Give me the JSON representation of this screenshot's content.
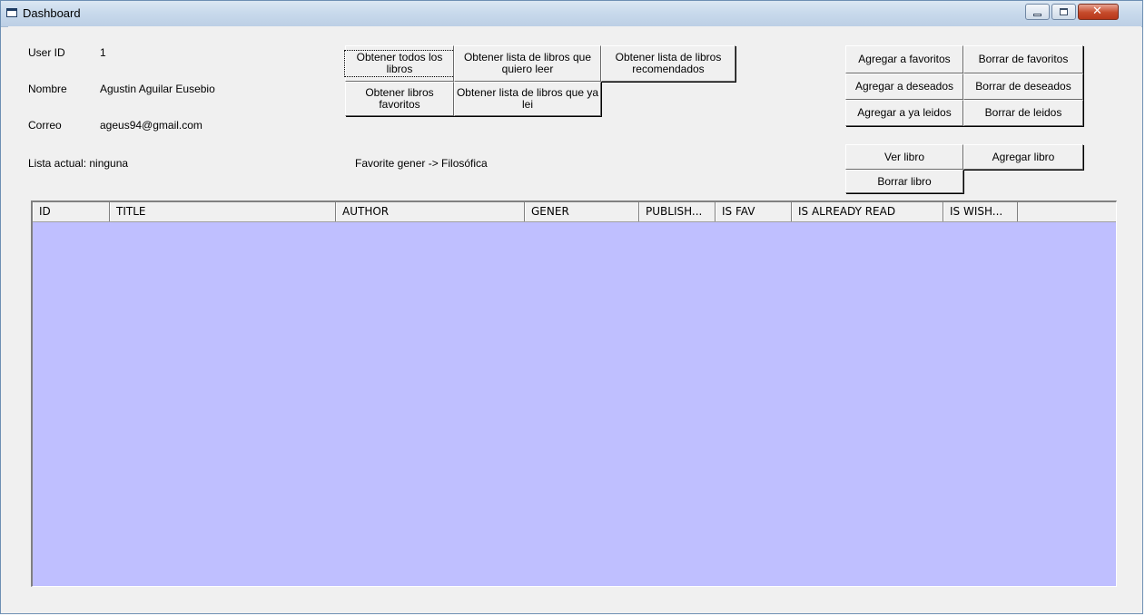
{
  "window": {
    "title": "Dashboard"
  },
  "user": {
    "id_label": "User ID",
    "id_value": "1",
    "name_label": "Nombre",
    "name_value": "Agustin Aguilar Eusebio",
    "email_label": "Correo",
    "email_value": "ageus94@gmail.com",
    "current_list": "Lista actual: ninguna",
    "favorite_gener": "Favorite gener -> Filosófica"
  },
  "list_buttons": {
    "all_books": "Obtener todos los libros",
    "want_to_read": "Obtener lista de libros que quiero leer",
    "recommended": "Obtener lista de libros recomendados",
    "favorites": "Obtener libros favoritos",
    "already_read": "Obtener lista de libros que ya lei"
  },
  "action_buttons": {
    "add_favorites": "Agregar a favoritos",
    "remove_favorites": "Borrar de favoritos",
    "add_wishlist": "Agregar a deseados",
    "remove_wishlist": "Borrar de deseados",
    "add_read": "Agregar a ya leidos",
    "remove_read": "Borrar de leidos",
    "view_book": "Ver libro",
    "add_book": "Agregar libro",
    "delete_book": "Borrar libro"
  },
  "table": {
    "columns": [
      "ID",
      "TITLE",
      "AUTHOR",
      "GENER",
      "PUBLISH...",
      "IS FAV",
      "IS ALREADY READ",
      "IS WISH..."
    ],
    "rows": []
  },
  "colors": {
    "list_background": "#bfbfff",
    "window_background": "#f0f0f0",
    "titlebar": "#c9daec"
  }
}
